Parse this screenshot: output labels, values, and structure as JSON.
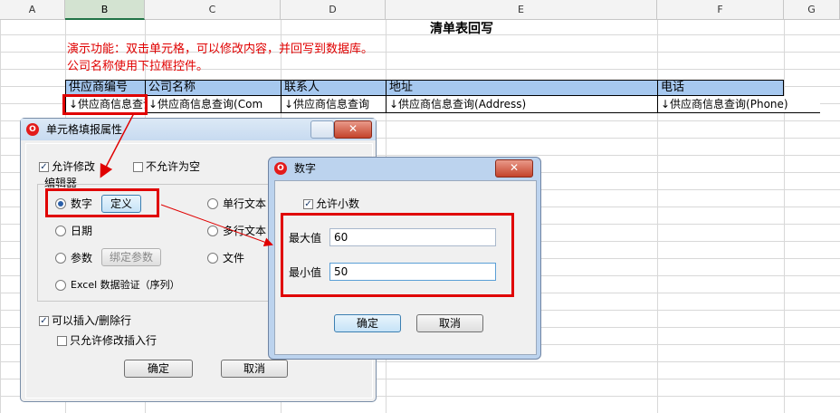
{
  "sheet": {
    "columns": [
      "A",
      "B",
      "C",
      "D",
      "E",
      "F",
      "G"
    ],
    "title": "清单表回写",
    "notes": [
      "演示功能：双击单元格，可以修改内容，并回写到数据库。",
      "公司名称使用下拉框控件。"
    ],
    "headers": [
      "供应商编号",
      "公司名称",
      "联系人",
      "地址",
      "电话"
    ],
    "row": [
      "↓供应商信息查询",
      "↓供应商信息查询(Com",
      "↓供应商信息查询",
      "↓供应商信息查询(Address)",
      "↓供应商信息查询(Phone)"
    ]
  },
  "cell_dialog": {
    "title": "单元格填报属性",
    "allow_edit": "允许修改",
    "not_null": "不允许为空",
    "editor_group": "编辑器",
    "opt_number": "数字",
    "define_btn": "定义",
    "opt_single_text": "单行文本",
    "opt_date": "日期",
    "opt_multi_text": "多行文本",
    "opt_param": "参数",
    "bind_param_btn": "绑定参数",
    "opt_file": "文件",
    "opt_excel": "Excel 数据验证（序列）",
    "allow_insert": "可以插入/删除行",
    "only_edit_insert": "只允许修改插入行",
    "ok": "确定",
    "cancel": "取消"
  },
  "number_dialog": {
    "title": "数字",
    "allow_decimal": "允许小数",
    "max_label": "最大值",
    "max_value": "60",
    "min_label": "最小值",
    "min_value": "50",
    "ok": "确定",
    "cancel": "取消"
  },
  "colors": {
    "highlight": "#e00000",
    "header_fill": "#a6c8ef"
  }
}
